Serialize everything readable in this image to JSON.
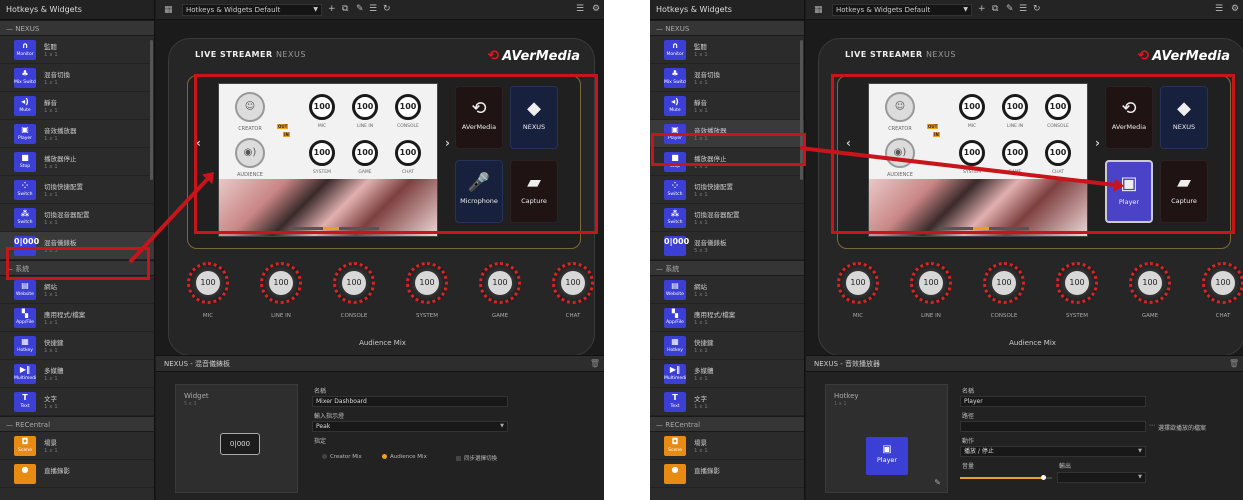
{
  "panels": [
    {
      "sidebar": {
        "title": "Hotkeys & Widgets",
        "groups": [
          {
            "label": "NEXUS",
            "items": [
              {
                "name": "監聽",
                "size": "1 x 1",
                "icon_label": "Monitor",
                "icon": "headphones-icon",
                "glyph": "∩"
              },
              {
                "name": "混音切換",
                "size": "1 x 1",
                "icon_label": "Mix Switch",
                "icon": "mix-switch-icon",
                "glyph": "♣"
              },
              {
                "name": "靜音",
                "size": "1 x 1",
                "icon_label": "Mute",
                "icon": "mute-icon",
                "glyph": "◂)"
              },
              {
                "name": "音效播放器",
                "size": "1 x 1",
                "icon_label": "Player",
                "icon": "player-icon",
                "glyph": "▣"
              },
              {
                "name": "播放器停止",
                "size": "1 x 1",
                "icon_label": "Stop",
                "icon": "stop-icon",
                "glyph": "■"
              },
              {
                "name": "切換快捷配置",
                "size": "1 x 1",
                "icon_label": "Switch",
                "icon": "switch-icon",
                "glyph": "⁘"
              },
              {
                "name": "切換混音器配置",
                "size": "1 x 1",
                "icon_label": "Switch",
                "icon": "switch-mixer-icon",
                "glyph": "⁂"
              },
              {
                "name": "混音儀錶板",
                "size": "5 x 3",
                "icon_label": "",
                "icon": "mixer-dashboard-icon",
                "glyph": "0|000",
                "selected": true
              }
            ]
          },
          {
            "label": "系統",
            "items": [
              {
                "name": "網站",
                "size": "1 x 1",
                "icon_label": "Website",
                "icon": "website-icon",
                "glyph": "▤"
              },
              {
                "name": "應用程式/檔案",
                "size": "1 x 1",
                "icon_label": "App/File",
                "icon": "app-file-icon",
                "glyph": "▚"
              },
              {
                "name": "快捷鍵",
                "size": "1 x 1",
                "icon_label": "Hotkey",
                "icon": "hotkey-icon",
                "glyph": "▦"
              },
              {
                "name": "多媒體",
                "size": "1 x 1",
                "icon_label": "Multimedia",
                "icon": "multimedia-icon",
                "glyph": "▶‖"
              },
              {
                "name": "文字",
                "size": "1 x 1",
                "icon_label": "Text",
                "icon": "text-icon",
                "glyph": "T"
              }
            ]
          },
          {
            "label": "RECentral",
            "items": [
              {
                "name": "場景",
                "size": "1 x 1",
                "icon_label": "Scene",
                "icon": "scene-icon",
                "glyph": "◘",
                "orange": true
              },
              {
                "name": "直播錄影",
                "size": "",
                "icon_label": "",
                "icon": "record-icon",
                "glyph": "●",
                "orange": true
              }
            ]
          }
        ]
      },
      "toolbar": {
        "profile": "Hotkeys & Widgets Default"
      },
      "device": {
        "title_bold": "LIVE STREAMER",
        "title_light": "NEXUS",
        "brand": "AVerMedia",
        "lcd": {
          "creator": "CREATOR",
          "audience": "AUDIENCE",
          "tag_out": "OUT",
          "tag_in": "IN",
          "knobs": [
            {
              "label": "MIC",
              "value": "100"
            },
            {
              "label": "LINE IN",
              "value": "100"
            },
            {
              "label": "CONSOLE",
              "value": "100"
            },
            {
              "label": "SYSTEM",
              "value": "100"
            },
            {
              "label": "GAME",
              "value": "100"
            },
            {
              "label": "CHAT",
              "value": "100"
            }
          ]
        },
        "pads": [
          {
            "label": "AVerMedia",
            "icon": "avermedia-logo-icon",
            "glyph": "⟲",
            "style": "dark"
          },
          {
            "label": "NEXUS",
            "icon": "nexus-icon",
            "glyph": "◆",
            "style": "blue"
          },
          {
            "label": "Microphone",
            "icon": "microphone-icon",
            "glyph": "🎤",
            "style": "blue"
          },
          {
            "label": "Capture",
            "icon": "capture-icon",
            "glyph": "▰",
            "style": "dark"
          }
        ],
        "big_knobs": [
          {
            "label": "MIC",
            "value": "100"
          },
          {
            "label": "LINE IN",
            "value": "100"
          },
          {
            "label": "CONSOLE",
            "value": "100"
          },
          {
            "label": "SYSTEM",
            "value": "100"
          },
          {
            "label": "GAME",
            "value": "100"
          },
          {
            "label": "CHAT",
            "value": "100"
          }
        ],
        "mix_title": "Audience Mix"
      },
      "props": {
        "header": "NEXUS - 混音儀錶板",
        "preview_title": "Widget",
        "preview_size": "5 x 3",
        "preview_glyph": "0|000",
        "name_label": "名稱",
        "name_value": "Mixer Dashboard",
        "mode_label": "輸入指示燈",
        "mode_value": "Peak",
        "assign_label": "指定",
        "radio1": "Creator Mix",
        "radio2": "Audience Mix",
        "check": "同步選擇切換"
      }
    },
    {
      "sidebar": {
        "title": "Hotkeys & Widgets",
        "groups": [
          {
            "label": "NEXUS",
            "items": [
              {
                "name": "監聽",
                "size": "1 x 1",
                "icon_label": "Monitor",
                "icon": "headphones-icon",
                "glyph": "∩"
              },
              {
                "name": "混音切換",
                "size": "1 x 1",
                "icon_label": "Mix Switch",
                "icon": "mix-switch-icon",
                "glyph": "♣"
              },
              {
                "name": "靜音",
                "size": "1 x 1",
                "icon_label": "Mute",
                "icon": "mute-icon",
                "glyph": "◂)"
              },
              {
                "name": "音效播放器",
                "size": "1 x 1",
                "icon_label": "Player",
                "icon": "player-icon",
                "glyph": "▣",
                "selected": true
              },
              {
                "name": "播放器停止",
                "size": "1 x 1",
                "icon_label": "Stop",
                "icon": "stop-icon",
                "glyph": "■"
              },
              {
                "name": "切換快捷配置",
                "size": "1 x 1",
                "icon_label": "Switch",
                "icon": "switch-icon",
                "glyph": "⁘"
              },
              {
                "name": "切換混音器配置",
                "size": "1 x 1",
                "icon_label": "Switch",
                "icon": "switch-mixer-icon",
                "glyph": "⁂"
              },
              {
                "name": "混音儀錶板",
                "size": "5 x 3",
                "icon_label": "",
                "icon": "mixer-dashboard-icon",
                "glyph": "0|000"
              }
            ]
          },
          {
            "label": "系統",
            "items": [
              {
                "name": "網站",
                "size": "1 x 1",
                "icon_label": "Website",
                "icon": "website-icon",
                "glyph": "▤"
              },
              {
                "name": "應用程式/檔案",
                "size": "1 x 1",
                "icon_label": "App/File",
                "icon": "app-file-icon",
                "glyph": "▚"
              },
              {
                "name": "快捷鍵",
                "size": "1 x 1",
                "icon_label": "Hotkey",
                "icon": "hotkey-icon",
                "glyph": "▦"
              },
              {
                "name": "多媒體",
                "size": "1 x 1",
                "icon_label": "Multimedia",
                "icon": "multimedia-icon",
                "glyph": "▶‖"
              },
              {
                "name": "文字",
                "size": "1 x 1",
                "icon_label": "Text",
                "icon": "text-icon",
                "glyph": "T"
              }
            ]
          },
          {
            "label": "RECentral",
            "items": [
              {
                "name": "場景",
                "size": "1 x 1",
                "icon_label": "Scene",
                "icon": "scene-icon",
                "glyph": "◘",
                "orange": true
              },
              {
                "name": "直播錄影",
                "size": "",
                "icon_label": "",
                "icon": "record-icon",
                "glyph": "●",
                "orange": true
              }
            ]
          }
        ]
      },
      "toolbar": {
        "profile": "Hotkeys & Widgets Default"
      },
      "device": {
        "title_bold": "LIVE STREAMER",
        "title_light": "NEXUS",
        "brand": "AVerMedia",
        "lcd": {
          "creator": "CREATOR",
          "audience": "AUDIENCE",
          "tag_out": "OUT",
          "tag_in": "IN",
          "knobs": [
            {
              "label": "MIC",
              "value": "100"
            },
            {
              "label": "LINE IN",
              "value": "100"
            },
            {
              "label": "CONSOLE",
              "value": "100"
            },
            {
              "label": "SYSTEM",
              "value": "100"
            },
            {
              "label": "GAME",
              "value": "100"
            },
            {
              "label": "CHAT",
              "value": "100"
            }
          ]
        },
        "pads": [
          {
            "label": "AVerMedia",
            "icon": "avermedia-logo-icon",
            "glyph": "⟲",
            "style": "dark"
          },
          {
            "label": "NEXUS",
            "icon": "nexus-icon",
            "glyph": "◆",
            "style": "blue"
          },
          {
            "label": "Player",
            "icon": "player-icon",
            "glyph": "▣",
            "style": "purple"
          },
          {
            "label": "Capture",
            "icon": "capture-icon",
            "glyph": "▰",
            "style": "dark"
          }
        ],
        "big_knobs": [
          {
            "label": "MIC",
            "value": "100"
          },
          {
            "label": "LINE IN",
            "value": "100"
          },
          {
            "label": "CONSOLE",
            "value": "100"
          },
          {
            "label": "SYSTEM",
            "value": "100"
          },
          {
            "label": "GAME",
            "value": "100"
          },
          {
            "label": "CHAT",
            "value": "100"
          }
        ],
        "mix_title": "Audience Mix"
      },
      "props": {
        "header": "NEXUS - 音效播放器",
        "preview_title": "Hotkey",
        "preview_size": "1 x 1",
        "preview_label": "Player",
        "name_label": "名稱",
        "name_value": "Player",
        "path_label": "路徑",
        "path_value": "",
        "path_hint": "選擇欲播放的檔案",
        "action_label": "動作",
        "action_value": "播放 / 停止",
        "volume_label": "音量",
        "volume_level": 0.9,
        "output_label": "輸出",
        "output_value": ""
      }
    }
  ],
  "colors": {
    "highlight": "#c8141b",
    "accent": "#f0a020",
    "widget_blue": "#3b3fd6"
  }
}
